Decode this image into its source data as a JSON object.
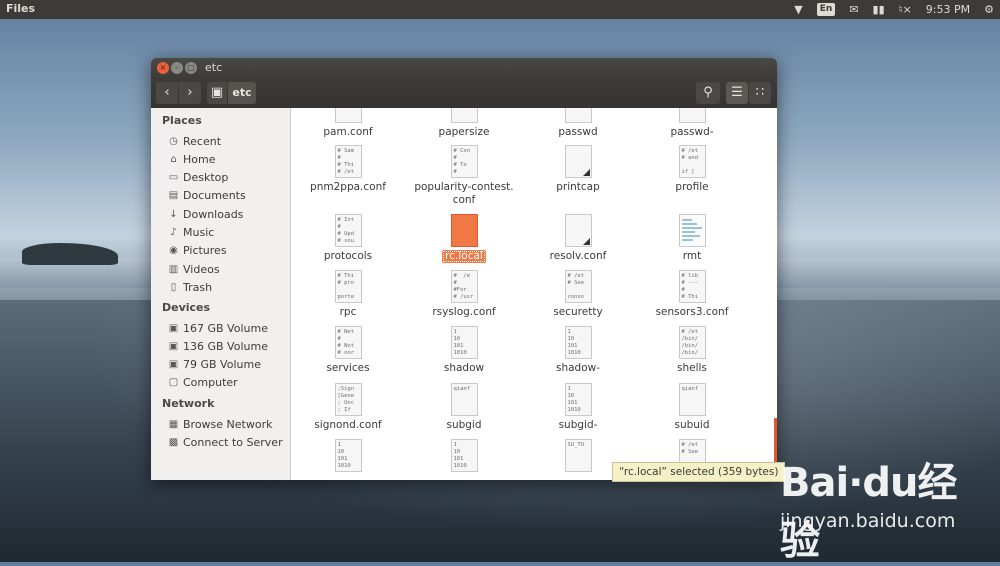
{
  "top_panel": {
    "app_title": "Files",
    "keyboard_layout": "En",
    "time": "9:53 PM"
  },
  "window": {
    "title": "etc",
    "path_crumb": "etc"
  },
  "sidebar": {
    "places_header": "Places",
    "places": [
      {
        "label": "Recent",
        "icon": "clock-icon"
      },
      {
        "label": "Home",
        "icon": "home-icon"
      },
      {
        "label": "Desktop",
        "icon": "desktop-icon"
      },
      {
        "label": "Documents",
        "icon": "document-icon"
      },
      {
        "label": "Downloads",
        "icon": "download-icon"
      },
      {
        "label": "Music",
        "icon": "music-icon"
      },
      {
        "label": "Pictures",
        "icon": "camera-icon"
      },
      {
        "label": "Videos",
        "icon": "film-icon"
      },
      {
        "label": "Trash",
        "icon": "trash-icon"
      }
    ],
    "devices_header": "Devices",
    "devices": [
      {
        "label": "167 GB Volume",
        "icon": "drive-icon"
      },
      {
        "label": "136 GB Volume",
        "icon": "drive-icon"
      },
      {
        "label": "79 GB Volume",
        "icon": "drive-icon"
      },
      {
        "label": "Computer",
        "icon": "computer-icon"
      }
    ],
    "network_header": "Network",
    "network": [
      {
        "label": "Browse Network",
        "icon": "network-icon"
      },
      {
        "label": "Connect to Server",
        "icon": "server-icon"
      }
    ]
  },
  "files": [
    {
      "name": "pam.conf",
      "preview": "# ---\n#"
    },
    {
      "name": "papersize",
      "preview": ""
    },
    {
      "name": "passwd",
      "preview": "bin:x\nsys:x"
    },
    {
      "name": "passwd-",
      "preview": "1010"
    },
    {
      "name": "pnm2ppa.conf",
      "preview": "# Sam\n#\n# Thi\n# /et"
    },
    {
      "name": "popularity-contest.\nconf",
      "preview": "# Con\n#\n# To\n#"
    },
    {
      "name": "printcap",
      "preview": "",
      "link": true
    },
    {
      "name": "profile",
      "preview": "# /et\n# and\n\nif ["
    },
    {
      "name": "protocols",
      "preview": "# Int\n#\n# Upd\n# sou"
    },
    {
      "name": "rc.local",
      "preview": "",
      "selected": true
    },
    {
      "name": "resolv.conf",
      "preview": "",
      "link": true
    },
    {
      "name": "rmt",
      "preview": "",
      "rmt": true
    },
    {
      "name": "rpc",
      "preview": "# Thi\n# pro\n\nporte"
    },
    {
      "name": "rsyslog.conf",
      "preview": "#  /e\n#\n#For\n# /usr"
    },
    {
      "name": "securetty",
      "preview": "# /et\n# See\n\nconso"
    },
    {
      "name": "sensors3.conf",
      "preview": "# lib\n# ---\n#\n# Thi"
    },
    {
      "name": "services",
      "preview": "# Net\n#\n# Not\n# nor"
    },
    {
      "name": "shadow",
      "preview": "1\n10\n101\n1010"
    },
    {
      "name": "shadow-",
      "preview": "1\n10\n101\n1010"
    },
    {
      "name": "shells",
      "preview": "# /et\n/bin/\n/bin/\n/bin/"
    },
    {
      "name": "signond.conf",
      "preview": ";Sign\n[Gene\n; Unc\n; If"
    },
    {
      "name": "subgid",
      "preview": "qianf"
    },
    {
      "name": "subgid-",
      "preview": "1\n10\n101\n1010"
    },
    {
      "name": "subuid",
      "preview": "qianf"
    },
    {
      "name": "",
      "preview": "1\n10\n101\n1010"
    },
    {
      "name": "",
      "preview": "1\n10\n101\n1010"
    },
    {
      "name": "",
      "preview": "SU_TO"
    },
    {
      "name": "",
      "preview": "# /et\n# See"
    }
  ],
  "status_bar": "“rc.local” selected  (359 bytes)",
  "watermark": {
    "brand": "Bai·du经验",
    "url": "jingyan.baidu.com"
  },
  "colors": {
    "selection": "#f07746",
    "panel": "#3c3b37"
  }
}
